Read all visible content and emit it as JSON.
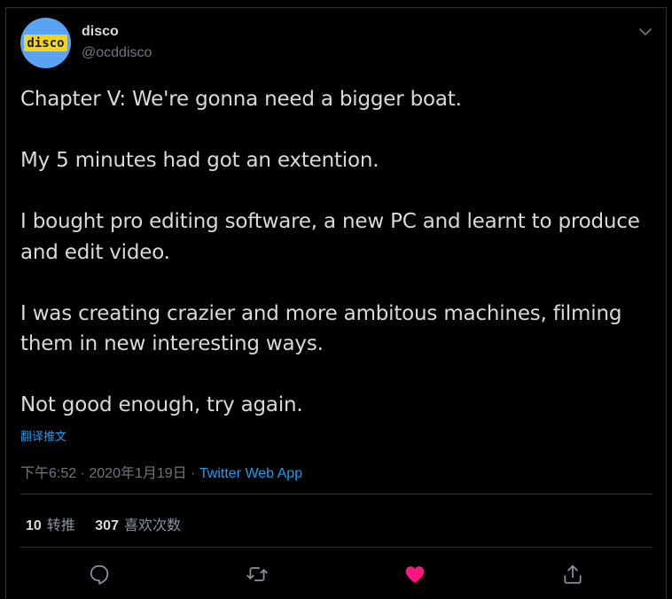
{
  "author": {
    "display_name": "disco",
    "handle": "@ocddisco",
    "avatar_text": "disco"
  },
  "tweet": {
    "paragraphs": [
      "Chapter V: We're gonna need a bigger boat.",
      "My 5 minutes had got an extention.",
      "I bought pro editing software, a new PC and learnt to produce and edit video.",
      "I was creating crazier and more ambitous machines, filming them in new interesting ways.",
      "Not good enough, try again."
    ],
    "translate_label": "翻译推文"
  },
  "meta": {
    "time": "下午6:52",
    "separator": " · ",
    "date": "2020年1月19日",
    "source": "Twitter Web App"
  },
  "stats": {
    "retweets_count": "10",
    "retweets_label": "转推",
    "likes_count": "307",
    "likes_label": "喜欢次数"
  },
  "icons": {
    "more": "chevron-down-icon",
    "reply": "reply-icon",
    "retweet": "retweet-icon",
    "like": "heart-icon",
    "share": "share-icon"
  },
  "colors": {
    "background": "#000000",
    "text": "#d9d9d9",
    "muted": "#6e767d",
    "link": "#1d9bf0",
    "like": "#f91880",
    "avatar_bg": "#5aa3f4",
    "avatar_text_bg": "#f2d41f"
  }
}
